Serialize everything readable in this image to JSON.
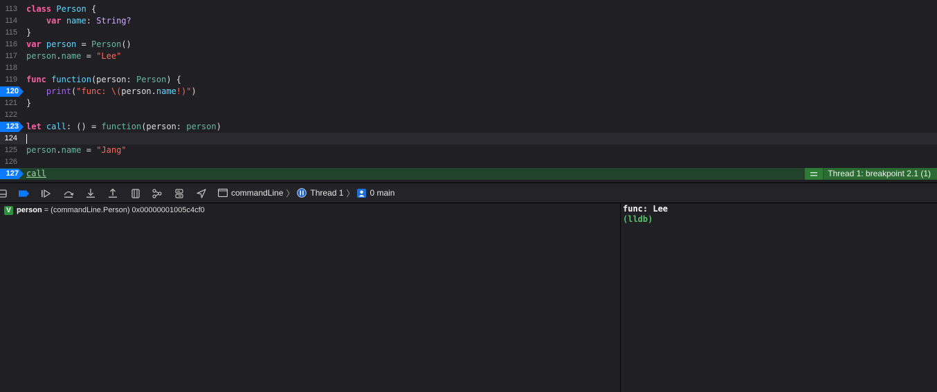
{
  "editor": {
    "lines": [
      {
        "num": "113"
      },
      {
        "num": "114"
      },
      {
        "num": "115"
      },
      {
        "num": "116"
      },
      {
        "num": "117"
      },
      {
        "num": "118"
      },
      {
        "num": "119"
      },
      {
        "num": "120",
        "breakpoint": true
      },
      {
        "num": "121"
      },
      {
        "num": "122"
      },
      {
        "num": "123",
        "breakpoint": true
      },
      {
        "num": "124",
        "current": true
      },
      {
        "num": "125"
      },
      {
        "num": "126"
      },
      {
        "num": "127",
        "breakpoint": true,
        "active": true
      }
    ],
    "code": {
      "l113": [
        "class",
        "Person",
        "{"
      ],
      "l114": [
        "var",
        "name",
        ": ",
        "String?"
      ],
      "l115": [
        "}"
      ],
      "l116": [
        "var",
        "person",
        " = ",
        "Person",
        "()"
      ],
      "l117": [
        "person",
        ".",
        "name",
        " = ",
        "\"Lee\""
      ],
      "l119": [
        "func",
        "function",
        "(person: ",
        "Person",
        ") {"
      ],
      "l120": [
        "print",
        "(",
        "\"func: \\(",
        "person",
        ".",
        "name",
        "!)\"",
        ")"
      ],
      "l121": [
        "}"
      ],
      "l123": [
        "let",
        "call",
        ": () = ",
        "function",
        "(person: ",
        "person",
        ")"
      ],
      "l125": [
        "person",
        ".",
        "name",
        " = ",
        "\"Jang\""
      ],
      "l127": [
        "call"
      ]
    },
    "annotation": {
      "icon": "equals-icon",
      "message": "Thread 1: breakpoint 2.1 (1)"
    }
  },
  "debugbar": {
    "buttons": [
      {
        "icon": "hide-debug-area-icon"
      },
      {
        "icon": "breakpoints-toggle-icon"
      },
      {
        "icon": "continue-icon"
      },
      {
        "icon": "step-over-icon"
      },
      {
        "icon": "step-into-icon"
      },
      {
        "icon": "step-out-icon"
      },
      {
        "icon": "view-hierarchy-icon"
      },
      {
        "icon": "memory-graph-icon"
      },
      {
        "icon": "environment-overrides-icon"
      },
      {
        "icon": "simulate-location-icon"
      }
    ],
    "breadcrumb": {
      "target": "commandLine",
      "thread": "Thread 1",
      "frame": "0 main"
    }
  },
  "variables": {
    "rows": [
      {
        "badge": "V",
        "name": "person",
        "value": "= (commandLine.Person) 0x00000001005c4cf0"
      }
    ]
  },
  "console": {
    "output": "func: Lee",
    "prompt": "(lldb)"
  },
  "colors": {
    "accent_breakpoint": "#0a7aff",
    "active_line": "#23422b",
    "annotation": "#2c6a33"
  }
}
